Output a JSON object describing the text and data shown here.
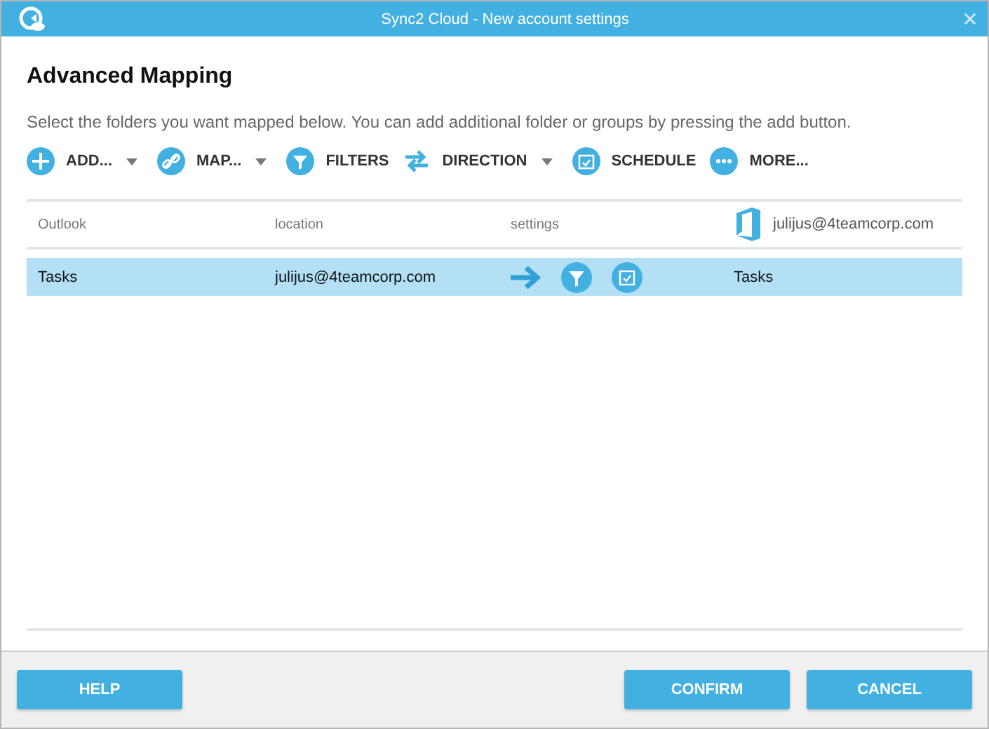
{
  "window": {
    "title": "Sync2 Cloud - New account settings"
  },
  "heading": "Advanced Mapping",
  "description": "Select the folders you want mapped below. You can add additional folder or groups by pressing the add button.",
  "toolbar": [
    {
      "kind": "add",
      "label": "ADD...",
      "dropdown": true
    },
    {
      "kind": "map",
      "label": "MAP...",
      "dropdown": true
    },
    {
      "kind": "filter",
      "label": "FILTERS",
      "dropdown": false
    },
    {
      "kind": "direction",
      "label": "DIRECTION",
      "dropdown": true
    },
    {
      "kind": "schedule",
      "label": "SCHEDULE",
      "dropdown": false
    },
    {
      "kind": "more",
      "label": "MORE...",
      "dropdown": false
    }
  ],
  "table": {
    "columns": [
      "Outlook",
      "location",
      "settings",
      "julijus@4teamcorp.com"
    ],
    "rows": [
      {
        "outlook": "Tasks",
        "location": "julijus@4teamcorp.com",
        "target": "Tasks",
        "selected": true
      }
    ]
  },
  "buttons": {
    "help": "HELP",
    "confirm": "CONFIRM",
    "cancel": "CANCEL"
  }
}
